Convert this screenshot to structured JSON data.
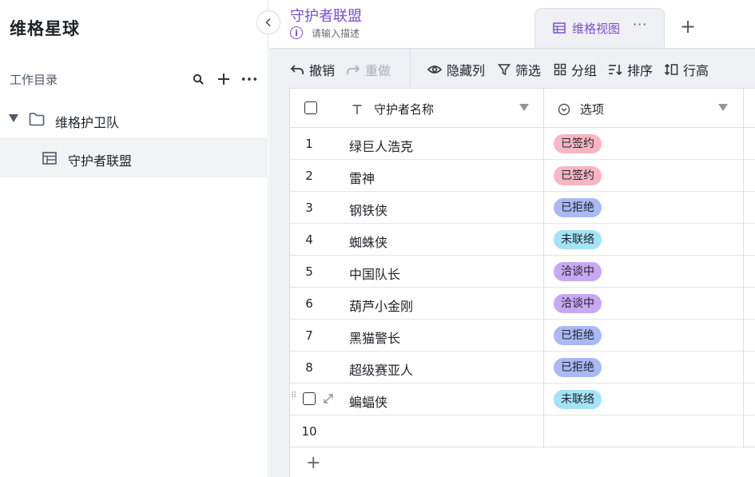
{
  "sidebar": {
    "brand": "维格星球",
    "directory_label": "工作目录",
    "folder": {
      "label": "维格护卫队"
    },
    "table": {
      "label": "守护者联盟"
    },
    "icons": [
      "collapse-icon",
      "search-icon",
      "plus-icon",
      "more-icon",
      "caret-down-icon",
      "folder-icon",
      "table-icon"
    ]
  },
  "header": {
    "title": "守护者联盟",
    "description_placeholder": "请输入描述",
    "view_tab": {
      "label": "维格视图",
      "more": "···"
    },
    "add_view": "+"
  },
  "toolbar": {
    "undo": "撤销",
    "redo": "重做",
    "hide_columns": "隐藏列",
    "filter": "筛选",
    "group": "分组",
    "sort": "排序",
    "row_height": "行高"
  },
  "grid": {
    "columns": [
      {
        "label": "守护者名称",
        "icon": "text-icon"
      },
      {
        "label": "选项",
        "icon": "single-select-icon"
      }
    ],
    "rows": [
      {
        "index": "1",
        "name": "绿巨人浩克",
        "option": "已签约",
        "color": "#f8b6c2"
      },
      {
        "index": "2",
        "name": "雷神",
        "option": "已签约",
        "color": "#f8b6c2"
      },
      {
        "index": "3",
        "name": "钢铁侠",
        "option": "已拒绝",
        "color": "#a9b9f3"
      },
      {
        "index": "4",
        "name": "蜘蛛侠",
        "option": "未联络",
        "color": "#a3e3f5"
      },
      {
        "index": "5",
        "name": "中国队长",
        "option": "洽谈中",
        "color": "#c7a8f2"
      },
      {
        "index": "6",
        "name": "葫芦小金刚",
        "option": "洽谈中",
        "color": "#c7a8f2"
      },
      {
        "index": "7",
        "name": "黑猫警长",
        "option": "已拒绝",
        "color": "#a9b9f3"
      },
      {
        "index": "8",
        "name": "超级赛亚人",
        "option": "已拒绝",
        "color": "#a9b9f3"
      },
      {
        "index": "",
        "name": "蝙蝠侠",
        "option": "未联络",
        "color": "#a3e3f5"
      },
      {
        "index": "10",
        "name": "",
        "option": "",
        "color": ""
      }
    ],
    "add_row": "+"
  }
}
